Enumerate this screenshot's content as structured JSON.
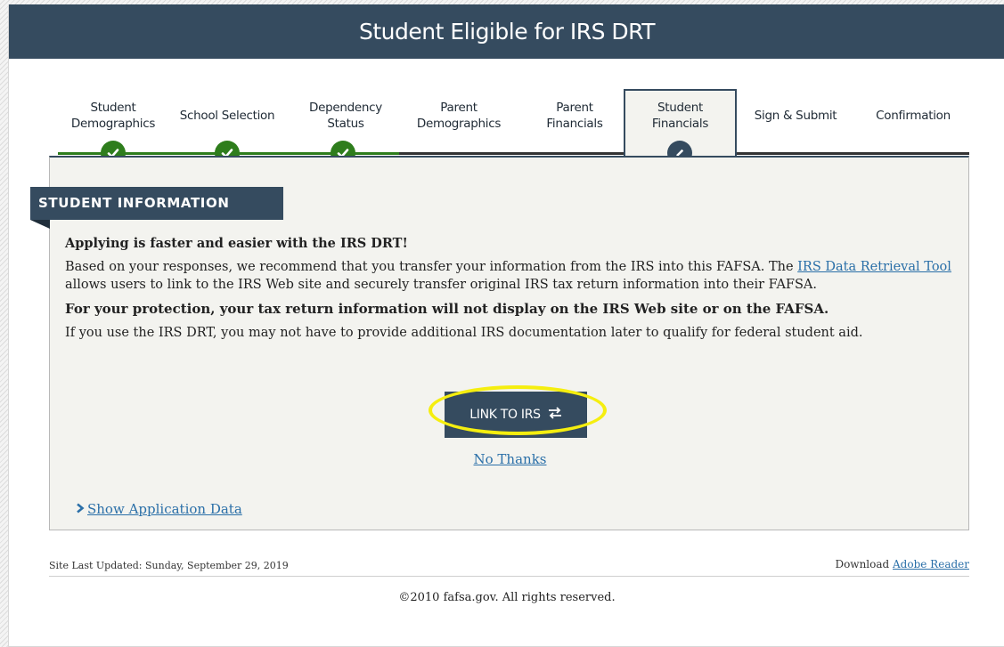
{
  "header": {
    "title": "Student Eligible for IRS DRT"
  },
  "steps": [
    {
      "line1": "Student",
      "line2": "Demographics",
      "status": "complete"
    },
    {
      "line1": "School Selection",
      "line2": "",
      "status": "complete"
    },
    {
      "line1": "Dependency",
      "line2": "Status",
      "status": "complete"
    },
    {
      "line1": "Parent",
      "line2": "Demographics",
      "status": "pending"
    },
    {
      "line1": "Parent",
      "line2": "Financials",
      "status": "pending"
    },
    {
      "line1": "Student",
      "line2": "Financials",
      "status": "current"
    },
    {
      "line1": "Sign & Submit",
      "line2": "",
      "status": "pending"
    },
    {
      "line1": "Confirmation",
      "line2": "",
      "status": "pending"
    }
  ],
  "section": {
    "title": "STUDENT INFORMATION"
  },
  "content": {
    "heading": "Applying is faster and easier with the IRS DRT!",
    "body_before_link": "Based on your responses, we recommend that you transfer your information from the IRS into this FAFSA. The ",
    "link_text": "IRS Data Retrieval Tool",
    "body_after_link": " allows users to link to the IRS Web site and securely transfer original IRS tax return information into their FAFSA.",
    "protection": "For your protection, your tax return information will not display on the IRS Web site or on the FAFSA.",
    "documentation": "If you use the IRS DRT, you may not have to provide additional IRS documentation later to qualify for federal student aid."
  },
  "actions": {
    "link_irs_label": "LINK TO IRS",
    "no_thanks_label": "No Thanks",
    "show_app_label": "Show Application Data"
  },
  "footer": {
    "updated": "Site Last Updated: Sunday, September 29, 2019",
    "download_prefix": "Download ",
    "download_link": "Adobe Reader",
    "copyright": "©2010 fafsa.gov. All rights reserved."
  },
  "colors": {
    "navy": "#354b5f",
    "complete_green": "#2e7d1c",
    "link_blue": "#2a6fa8",
    "highlight_yellow": "#f5ee0f",
    "panel_bg": "#f3f3ef"
  }
}
